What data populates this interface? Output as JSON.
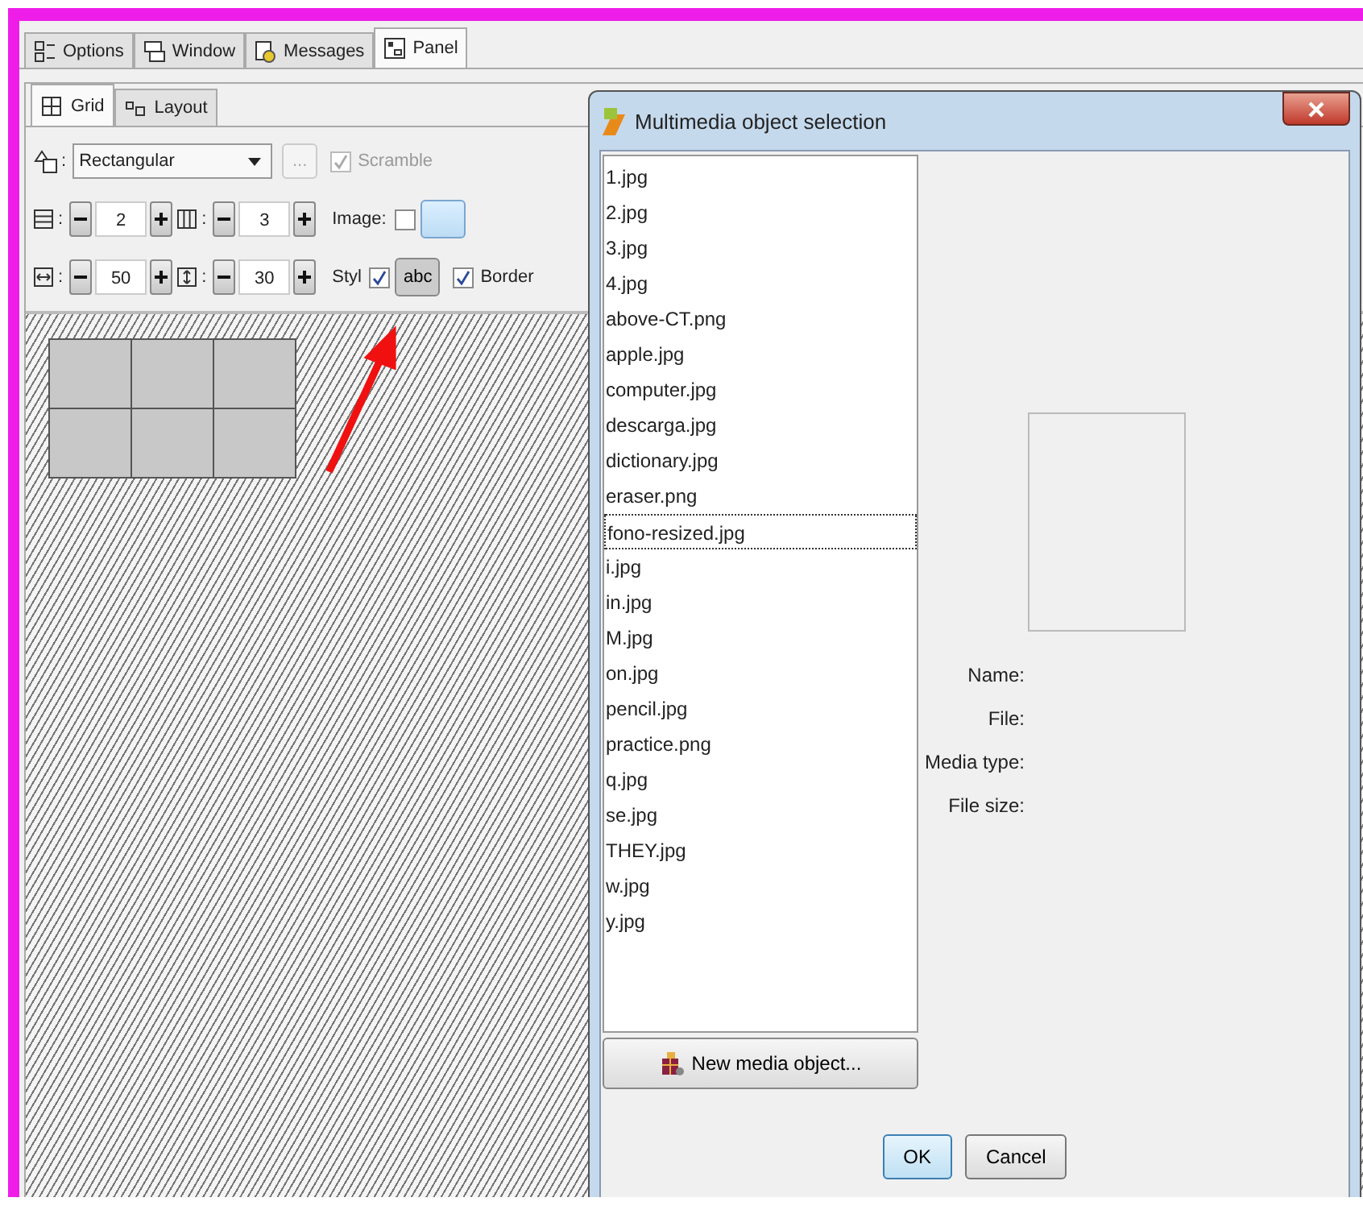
{
  "tabs": [
    {
      "label": "Options",
      "kind": "options",
      "selected": false
    },
    {
      "label": "Window",
      "kind": "window",
      "selected": false
    },
    {
      "label": "Messages",
      "kind": "messages",
      "selected": false
    },
    {
      "label": "Panel",
      "kind": "panel",
      "selected": true
    }
  ],
  "subtabs": [
    {
      "label": "Grid",
      "kind": "grid",
      "selected": true
    },
    {
      "label": "Layout",
      "kind": "layout",
      "selected": false
    }
  ],
  "shape": {
    "label": ":",
    "value": "Rectangular"
  },
  "more_button": {
    "label": "...",
    "disabled": true
  },
  "scramble": {
    "label": "Scramble",
    "checked": true,
    "disabled": true
  },
  "spinners": [
    {
      "kind": "rows",
      "label": ":",
      "value": "2"
    },
    {
      "kind": "columns",
      "label": ":",
      "value": "3"
    },
    {
      "kind": "width",
      "label": ":",
      "value": "50"
    },
    {
      "kind": "height",
      "label": ":",
      "value": "30"
    }
  ],
  "image": {
    "label": "Image:",
    "checked": false
  },
  "style": {
    "label": "Styl",
    "checked": true,
    "button": "abc"
  },
  "border": {
    "label": "Border",
    "checked": true
  },
  "dialog": {
    "title": "Multimedia object selection",
    "files": [
      {
        "name": "1.jpg",
        "focused": false
      },
      {
        "name": "2.jpg",
        "focused": false
      },
      {
        "name": "3.jpg",
        "focused": false
      },
      {
        "name": "4.jpg",
        "focused": false
      },
      {
        "name": "above-CT.png",
        "focused": false
      },
      {
        "name": "apple.jpg",
        "focused": false
      },
      {
        "name": "computer.jpg",
        "focused": false
      },
      {
        "name": "descarga.jpg",
        "focused": false
      },
      {
        "name": "dictionary.jpg",
        "focused": false
      },
      {
        "name": "eraser.png",
        "focused": false
      },
      {
        "name": "fono-resized.jpg",
        "focused": true
      },
      {
        "name": "i.jpg",
        "focused": false
      },
      {
        "name": "in.jpg",
        "focused": false
      },
      {
        "name": "M.jpg",
        "focused": false
      },
      {
        "name": "on.jpg",
        "focused": false
      },
      {
        "name": "pencil.jpg",
        "focused": false
      },
      {
        "name": "practice.png",
        "focused": false
      },
      {
        "name": "q.jpg",
        "focused": false
      },
      {
        "name": "se.jpg",
        "focused": false
      },
      {
        "name": "THEY.jpg",
        "focused": false
      },
      {
        "name": "w.jpg",
        "focused": false
      },
      {
        "name": "y.jpg",
        "focused": false
      }
    ],
    "new_button": "New media object...",
    "details": [
      "Name:",
      "File:",
      "Media type:",
      "File size:"
    ],
    "buttons": [
      {
        "label": "OK",
        "default": true
      },
      {
        "label": "Cancel",
        "default": false
      }
    ]
  }
}
